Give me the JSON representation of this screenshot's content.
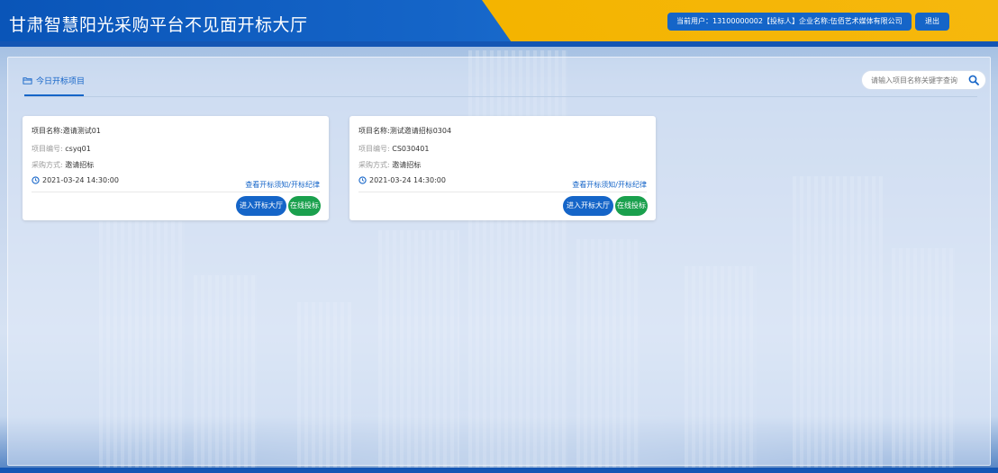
{
  "header": {
    "title": "甘肃智慧阳光采购平台不见面开标大厅",
    "user_info": "当前用户：13100000002【投标人】企业名称:伍佰艺术媒体有限公司",
    "logout_label": "退出"
  },
  "section": {
    "title": "今日开标项目"
  },
  "search": {
    "placeholder": "请输入项目名称关键字查询",
    "value": ""
  },
  "projects": [
    {
      "name_label": "项目名称:",
      "name": "邀请测试01",
      "code_label": "项目编号:",
      "code": "csyq01",
      "method_label": "采购方式:",
      "method": "邀请招标",
      "time": "2021-03-24 14:30:00",
      "notice_link": "查看开标须知/开标纪律",
      "enter_label": "进入开标大厅",
      "bid_label": "在线投标"
    },
    {
      "name_label": "项目名称:",
      "name": "测试邀请招标0304",
      "code_label": "项目编号:",
      "code": "CS030401",
      "method_label": "采购方式:",
      "method": "邀请招标",
      "time": "2021-03-24 14:30:00",
      "notice_link": "查看开标须知/开标纪律",
      "enter_label": "进入开标大厅",
      "bid_label": "在线投标"
    }
  ],
  "colors": {
    "primary": "#1565c8",
    "accent": "#f4b400",
    "success": "#1aa04d"
  },
  "icons": {
    "section": "folder-icon",
    "search": "search-icon",
    "time": "clock-icon"
  }
}
